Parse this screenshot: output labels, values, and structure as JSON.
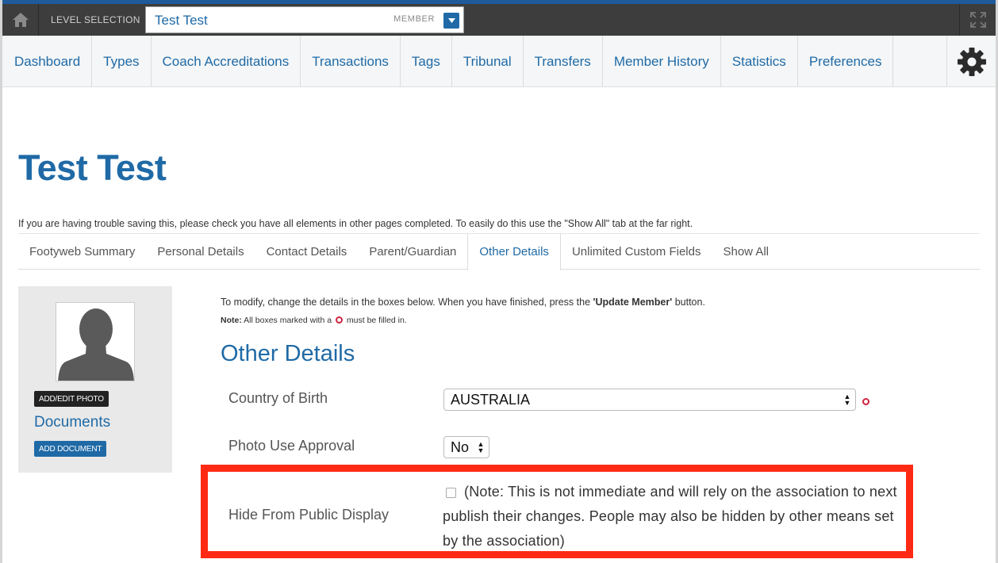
{
  "topbar": {
    "level_label": "LEVEL SELECTION",
    "level_name": "Test Test",
    "level_type": "MEMBER",
    "icons": {
      "home": "home-icon",
      "dropdown": "caret-down-icon",
      "expand": "expand-icon"
    }
  },
  "nav": {
    "items": [
      {
        "label": "Dashboard"
      },
      {
        "label": "Types"
      },
      {
        "label": "Coach Accreditations"
      },
      {
        "label": "Transactions"
      },
      {
        "label": "Tags"
      },
      {
        "label": "Tribunal"
      },
      {
        "label": "Transfers"
      },
      {
        "label": "Member History"
      },
      {
        "label": "Statistics"
      },
      {
        "label": "Preferences"
      }
    ],
    "settings_icon": "gear-icon"
  },
  "page": {
    "title": "Test Test",
    "trouble_note": "If you are having trouble saving this, please check you have all elements in other pages completed. To easily do this use the \"Show All\" tab at the far right."
  },
  "tabs": {
    "items": [
      {
        "label": "Footyweb Summary"
      },
      {
        "label": "Personal Details"
      },
      {
        "label": "Contact Details"
      },
      {
        "label": "Parent/Guardian"
      },
      {
        "label": "Other Details"
      },
      {
        "label": "Unlimited Custom Fields"
      },
      {
        "label": "Show All"
      }
    ],
    "active": "Other Details"
  },
  "sidebar": {
    "photo_button": "ADD/EDIT PHOTO",
    "documents_title": "Documents",
    "document_button": "ADD DOCUMENT"
  },
  "form": {
    "instructions_pre": "To modify, change the details in the boxes below. When you have finished, press the ",
    "instructions_button": "'Update Member'",
    "instructions_post": " button.",
    "note_label": "Note:",
    "note_pre": " All boxes marked with a ",
    "note_post": " must be filled in.",
    "section_title": "Other Details",
    "fields": {
      "country": {
        "label": "Country of Birth",
        "value": "AUSTRALIA",
        "required": true
      },
      "photo_use": {
        "label": "Photo Use Approval",
        "value": "No"
      },
      "hide": {
        "label": "Hide From Public Display",
        "checked": false,
        "note": "(Note: This is not immediate and will rely on the association to next publish their changes. People may also be hidden by other means set by the association)"
      }
    }
  },
  "colors": {
    "brand": "#1f6aa6",
    "topbar": "#3d3d3d",
    "highlight": "#ff2a14",
    "required": "#d0243d"
  }
}
